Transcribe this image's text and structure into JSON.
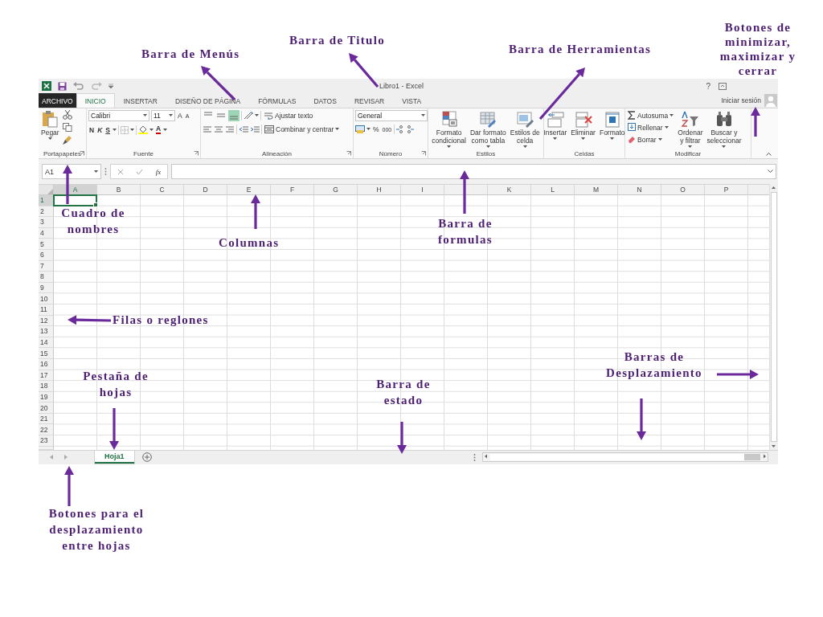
{
  "window": {
    "title": "Libro1 - Excel",
    "help": "?",
    "account": "Iniciar sesión"
  },
  "tabs": [
    {
      "label": "ARCHIVO",
      "kind": "file",
      "selected": false
    },
    {
      "label": "INICIO",
      "kind": "tab",
      "selected": true
    },
    {
      "label": "INSERTAR",
      "kind": "tab",
      "selected": false
    },
    {
      "label": "DISEÑO DE PÁGINA",
      "kind": "tab",
      "selected": false
    },
    {
      "label": "FÓRMULAS",
      "kind": "tab",
      "selected": false
    },
    {
      "label": "DATOS",
      "kind": "tab",
      "selected": false
    },
    {
      "label": "REVISAR",
      "kind": "tab",
      "selected": false
    },
    {
      "label": "VISTA",
      "kind": "tab",
      "selected": false
    }
  ],
  "ribbon": {
    "groups": [
      {
        "kind": "clipboard",
        "label": "Portapapeles",
        "paste": "Pegar"
      },
      {
        "kind": "font",
        "label": "Fuente",
        "font": "Calibri",
        "size": "11",
        "grow": "A",
        "shrink": "A",
        "bold": "N",
        "italic": "K",
        "underline": "S",
        "font_color": "A"
      },
      {
        "kind": "alignment",
        "label": "Alineación",
        "vertical": [
          {
            "kind": "top",
            "selected": false
          },
          {
            "kind": "middle",
            "selected": false
          },
          {
            "kind": "bottom",
            "selected": true
          }
        ],
        "wrap": "Ajustar texto",
        "merge": "Combinar y centrar"
      },
      {
        "kind": "number",
        "label": "Número",
        "format": "General",
        "percent": "%",
        "thousands": "000"
      },
      {
        "kind": "large",
        "label": "Estilos",
        "buttons": [
          {
            "text": "Formato\ncondicional",
            "kind": "conditional"
          },
          {
            "text": "Dar formato\ncomo tabla",
            "kind": "table"
          },
          {
            "text": "Estilos de\ncelda",
            "kind": "styles"
          }
        ]
      },
      {
        "kind": "large",
        "label": "Celdas",
        "buttons": [
          {
            "text": "Insertar",
            "kind": "insert"
          },
          {
            "text": "Eliminar",
            "kind": "delete"
          },
          {
            "text": "Formato",
            "kind": "format"
          }
        ]
      },
      {
        "kind": "edit",
        "label": "Modificar",
        "small": [
          {
            "text": "Autosuma",
            "kind": "sum"
          },
          {
            "text": "Rellenar",
            "kind": "fill"
          },
          {
            "text": "Borrar",
            "kind": "clear"
          }
        ],
        "buttons": [
          {
            "text": "Ordenar\ny filtrar",
            "kind": "sort"
          },
          {
            "text": "Buscar y\nseleccionar",
            "kind": "find"
          }
        ]
      }
    ]
  },
  "formula_bar": {
    "name_box": "A1",
    "function_label": "fx"
  },
  "sheet": {
    "columns": [
      {
        "label": "A",
        "selected": true
      },
      {
        "label": "B",
        "selected": false
      },
      {
        "label": "C",
        "selected": false
      },
      {
        "label": "D",
        "selected": false
      },
      {
        "label": "E",
        "selected": false
      },
      {
        "label": "F",
        "selected": false
      },
      {
        "label": "G",
        "selected": false
      },
      {
        "label": "H",
        "selected": false
      },
      {
        "label": "I",
        "selected": false
      },
      {
        "selected": false
      },
      {
        "label": "K",
        "selected": false
      },
      {
        "label": "L",
        "selected": false
      },
      {
        "label": "M",
        "selected": false
      },
      {
        "label": "N",
        "selected": false
      },
      {
        "label": "O",
        "selected": false
      },
      {
        "label": "P",
        "selected": false
      }
    ],
    "rows": [
      {
        "label": "1",
        "selected": true
      },
      {
        "label": "2",
        "selected": false
      },
      {
        "label": "3",
        "selected": false
      },
      {
        "label": "4",
        "selected": false
      },
      {
        "label": "5",
        "selected": false
      },
      {
        "label": "6",
        "selected": false
      },
      {
        "label": "7",
        "selected": false
      },
      {
        "label": "8",
        "selected": false
      },
      {
        "label": "9",
        "selected": false
      },
      {
        "label": "10",
        "selected": false
      },
      {
        "label": "11",
        "selected": false
      },
      {
        "label": "12",
        "selected": false
      },
      {
        "label": "13",
        "selected": false
      },
      {
        "label": "14",
        "selected": false
      },
      {
        "label": "15",
        "selected": false
      },
      {
        "label": "16",
        "selected": false
      },
      {
        "label": "17",
        "selected": false
      },
      {
        "label": "18",
        "selected": false
      },
      {
        "label": "19",
        "selected": false
      },
      {
        "label": "20",
        "selected": false
      },
      {
        "label": "21",
        "selected": false
      },
      {
        "label": "22",
        "selected": false
      },
      {
        "label": "23",
        "selected": false
      }
    ]
  },
  "sheet_tabs": [
    {
      "label": "Hoja1",
      "selected": true
    }
  ],
  "annotations": [
    {
      "text": "Barra de Menús"
    },
    {
      "text": "Barra de Titulo"
    },
    {
      "text": "Barra de Herramientas"
    },
    {
      "text": "Botones de\nminimizar,\nmaximizar y\ncerrar"
    },
    {
      "text": "Cuadro de\nnombres"
    },
    {
      "text": "Columnas"
    },
    {
      "text": "Barra de\nformulas"
    },
    {
      "text": "Filas o reglones"
    },
    {
      "text": "Pestaña de\nhojas"
    },
    {
      "text": "Barra de\nestado"
    },
    {
      "text": "Barras de\nDesplazamiento"
    },
    {
      "text": "Botones para el\ndesplazamiento\nentre hojas"
    }
  ]
}
